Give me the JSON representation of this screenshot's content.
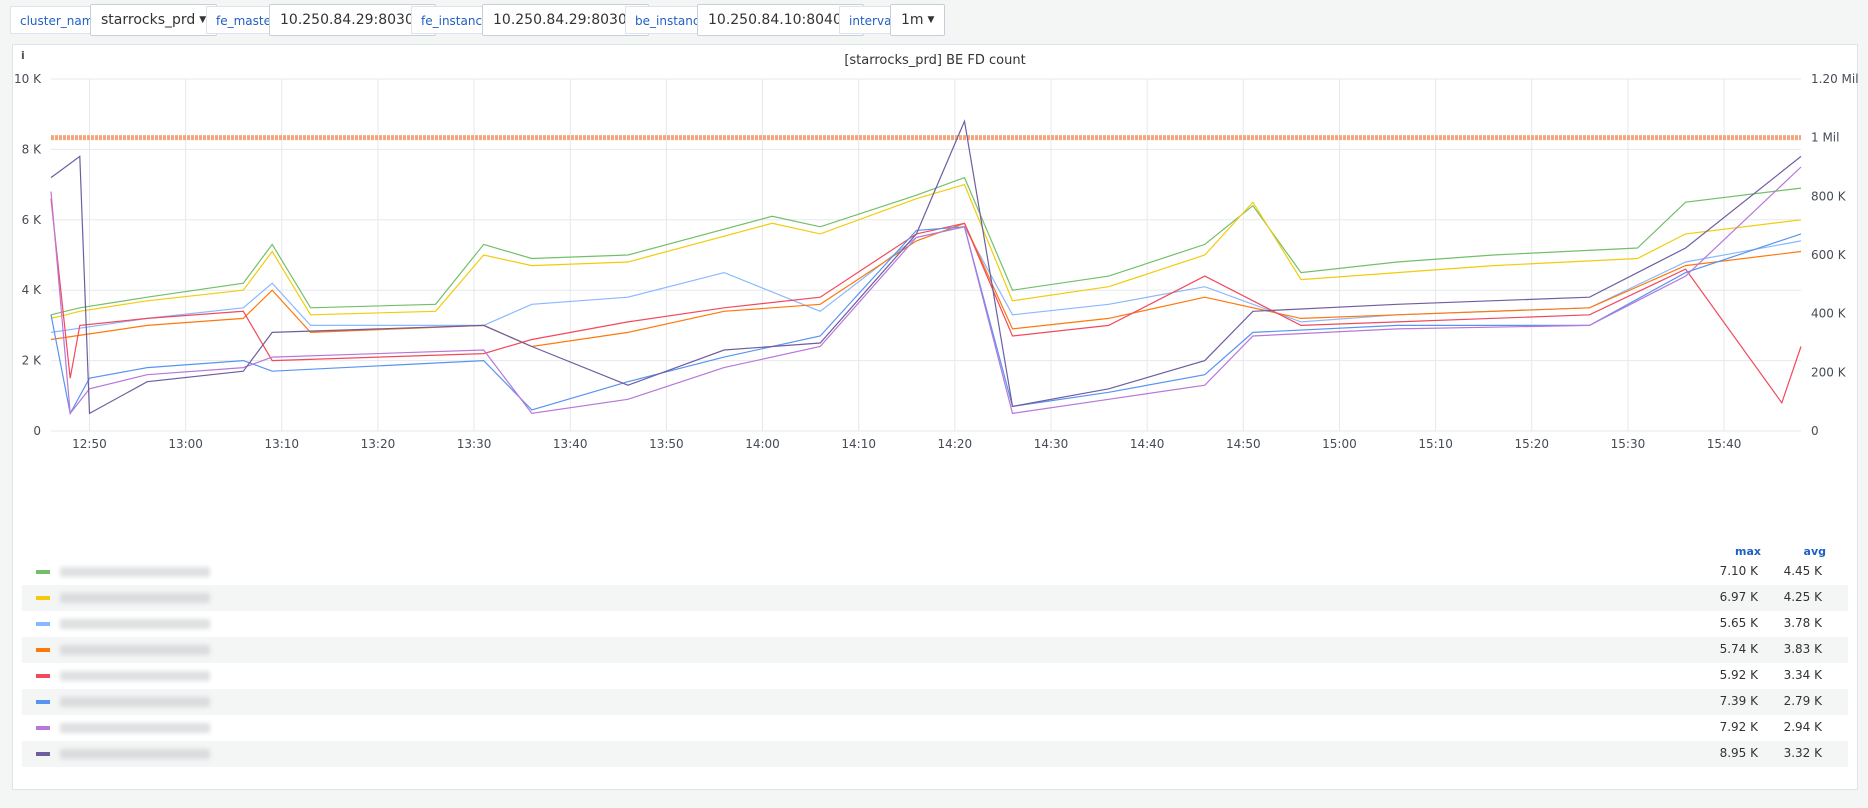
{
  "variables": [
    {
      "label": "cluster_name",
      "value": "starrocks_prd"
    },
    {
      "label": "fe_master",
      "value": "10.250.84.29:8030"
    },
    {
      "label": "fe_instance",
      "value": "10.250.84.29:8030"
    },
    {
      "label": "be_instance",
      "value": "10.250.84.10:8040"
    },
    {
      "label": "interval",
      "value": "1m"
    }
  ],
  "panel": {
    "info_icon": "i",
    "title": "[starrocks_prd] BE FD count"
  },
  "legend": {
    "headers": {
      "max": "max",
      "avg": "avg"
    },
    "rows": [
      {
        "color": "#73bf69",
        "max": "7.10 K",
        "avg": "4.45 K"
      },
      {
        "color": "#f2cc0c",
        "max": "6.97 K",
        "avg": "4.25 K"
      },
      {
        "color": "#8ab8ff",
        "max": "5.65 K",
        "avg": "3.78 K"
      },
      {
        "color": "#ff780a",
        "max": "5.74 K",
        "avg": "3.83 K"
      },
      {
        "color": "#f2495c",
        "max": "5.92 K",
        "avg": "3.34 K"
      },
      {
        "color": "#5794f2",
        "max": "7.39 K",
        "avg": "2.79 K"
      },
      {
        "color": "#b877d9",
        "max": "7.92 K",
        "avg": "2.94 K"
      },
      {
        "color": "#705da0",
        "max": "8.95 K",
        "avg": "3.32 K"
      }
    ]
  },
  "chart_data": {
    "type": "line",
    "title": "[starrocks_prd] BE FD count",
    "xlabel": "",
    "ylabel": "",
    "x_range": [
      "12:46",
      "15:48"
    ],
    "x_ticks": [
      "12:50",
      "13:00",
      "13:10",
      "13:20",
      "13:30",
      "13:40",
      "13:50",
      "14:00",
      "14:10",
      "14:20",
      "14:30",
      "14:40",
      "14:50",
      "15:00",
      "15:10",
      "15:20",
      "15:30",
      "15:40"
    ],
    "y_left": {
      "ticks": [
        "0",
        "2 K",
        "4 K",
        "6 K",
        "8 K",
        "10 K"
      ],
      "range": [
        0,
        10000
      ]
    },
    "y_right": {
      "ticks": [
        "0",
        "200 K",
        "400 K",
        "600 K",
        "800 K",
        "1 Mil",
        "1.20 Mil"
      ],
      "range": [
        0,
        1200000
      ]
    },
    "grid": true,
    "limit_series": {
      "color": "#f4a77c",
      "axis": "right",
      "value": 1000000
    },
    "series": [
      {
        "color": "#73bf69",
        "points": [
          [
            0,
            3300
          ],
          [
            3,
            3500
          ],
          [
            10,
            3800
          ],
          [
            20,
            4200
          ],
          [
            23,
            5300
          ],
          [
            27,
            3500
          ],
          [
            40,
            3600
          ],
          [
            45,
            5300
          ],
          [
            50,
            4900
          ],
          [
            60,
            5000
          ],
          [
            75,
            6100
          ],
          [
            80,
            5800
          ],
          [
            90,
            6700
          ],
          [
            95,
            7200
          ],
          [
            100,
            4000
          ],
          [
            110,
            4400
          ],
          [
            120,
            5300
          ],
          [
            125,
            6400
          ],
          [
            130,
            4500
          ],
          [
            140,
            4800
          ],
          [
            150,
            5000
          ],
          [
            165,
            5200
          ],
          [
            170,
            6500
          ],
          [
            182,
            6900
          ]
        ]
      },
      {
        "color": "#f2cc0c",
        "points": [
          [
            0,
            3200
          ],
          [
            3,
            3400
          ],
          [
            10,
            3700
          ],
          [
            20,
            4000
          ],
          [
            23,
            5100
          ],
          [
            27,
            3300
          ],
          [
            40,
            3400
          ],
          [
            45,
            5000
          ],
          [
            50,
            4700
          ],
          [
            60,
            4800
          ],
          [
            75,
            5900
          ],
          [
            80,
            5600
          ],
          [
            90,
            6600
          ],
          [
            95,
            7000
          ],
          [
            100,
            3700
          ],
          [
            110,
            4100
          ],
          [
            120,
            5000
          ],
          [
            125,
            6500
          ],
          [
            130,
            4300
          ],
          [
            140,
            4500
          ],
          [
            150,
            4700
          ],
          [
            165,
            4900
          ],
          [
            170,
            5600
          ],
          [
            182,
            6000
          ]
        ]
      },
      {
        "color": "#8ab8ff",
        "points": [
          [
            0,
            2800
          ],
          [
            10,
            3200
          ],
          [
            20,
            3500
          ],
          [
            23,
            4200
          ],
          [
            27,
            3000
          ],
          [
            45,
            3000
          ],
          [
            50,
            3600
          ],
          [
            60,
            3800
          ],
          [
            70,
            4500
          ],
          [
            80,
            3400
          ],
          [
            90,
            5500
          ],
          [
            95,
            5800
          ],
          [
            100,
            3300
          ],
          [
            110,
            3600
          ],
          [
            120,
            4100
          ],
          [
            130,
            3100
          ],
          [
            140,
            3300
          ],
          [
            160,
            3500
          ],
          [
            170,
            4800
          ],
          [
            182,
            5400
          ]
        ]
      },
      {
        "color": "#ff780a",
        "points": [
          [
            0,
            2600
          ],
          [
            10,
            3000
          ],
          [
            20,
            3200
          ],
          [
            23,
            4000
          ],
          [
            27,
            2800
          ],
          [
            45,
            3000
          ],
          [
            50,
            2400
          ],
          [
            60,
            2800
          ],
          [
            70,
            3400
          ],
          [
            80,
            3600
          ],
          [
            90,
            5400
          ],
          [
            95,
            5900
          ],
          [
            100,
            2900
          ],
          [
            110,
            3200
          ],
          [
            120,
            3800
          ],
          [
            130,
            3200
          ],
          [
            140,
            3300
          ],
          [
            160,
            3500
          ],
          [
            170,
            4700
          ],
          [
            182,
            5100
          ]
        ]
      },
      {
        "color": "#f2495c",
        "points": [
          [
            0,
            6600
          ],
          [
            2,
            1500
          ],
          [
            3,
            3000
          ],
          [
            10,
            3200
          ],
          [
            20,
            3400
          ],
          [
            23,
            2000
          ],
          [
            45,
            2200
          ],
          [
            50,
            2600
          ],
          [
            60,
            3100
          ],
          [
            70,
            3500
          ],
          [
            80,
            3800
          ],
          [
            90,
            5600
          ],
          [
            95,
            5900
          ],
          [
            100,
            2700
          ],
          [
            110,
            3000
          ],
          [
            120,
            4400
          ],
          [
            130,
            3000
          ],
          [
            140,
            3100
          ],
          [
            160,
            3300
          ],
          [
            170,
            4600
          ],
          [
            180,
            800
          ],
          [
            182,
            2400
          ]
        ]
      },
      {
        "color": "#5794f2",
        "points": [
          [
            0,
            3300
          ],
          [
            2,
            500
          ],
          [
            4,
            1500
          ],
          [
            10,
            1800
          ],
          [
            20,
            2000
          ],
          [
            23,
            1700
          ],
          [
            45,
            2000
          ],
          [
            50,
            600
          ],
          [
            60,
            1400
          ],
          [
            70,
            2100
          ],
          [
            80,
            2700
          ],
          [
            90,
            5700
          ],
          [
            95,
            5800
          ],
          [
            100,
            700
          ],
          [
            110,
            1100
          ],
          [
            120,
            1600
          ],
          [
            125,
            2800
          ],
          [
            140,
            3000
          ],
          [
            160,
            3000
          ],
          [
            170,
            4500
          ],
          [
            182,
            5600
          ]
        ]
      },
      {
        "color": "#b877d9",
        "points": [
          [
            0,
            6800
          ],
          [
            2,
            500
          ],
          [
            4,
            1200
          ],
          [
            10,
            1600
          ],
          [
            20,
            1800
          ],
          [
            23,
            2100
          ],
          [
            45,
            2300
          ],
          [
            50,
            500
          ],
          [
            60,
            900
          ],
          [
            70,
            1800
          ],
          [
            80,
            2400
          ],
          [
            90,
            5500
          ],
          [
            95,
            5800
          ],
          [
            100,
            500
          ],
          [
            110,
            900
          ],
          [
            120,
            1300
          ],
          [
            125,
            2700
          ],
          [
            140,
            2900
          ],
          [
            160,
            3000
          ],
          [
            170,
            4400
          ],
          [
            182,
            7500
          ]
        ]
      },
      {
        "color": "#705da0",
        "points": [
          [
            0,
            7200
          ],
          [
            3,
            7800
          ],
          [
            4,
            500
          ],
          [
            10,
            1400
          ],
          [
            20,
            1700
          ],
          [
            23,
            2800
          ],
          [
            45,
            3000
          ],
          [
            50,
            2400
          ],
          [
            60,
            1300
          ],
          [
            70,
            2300
          ],
          [
            80,
            2500
          ],
          [
            90,
            5600
          ],
          [
            95,
            8800
          ],
          [
            100,
            700
          ],
          [
            110,
            1200
          ],
          [
            120,
            2000
          ],
          [
            125,
            3400
          ],
          [
            140,
            3600
          ],
          [
            160,
            3800
          ],
          [
            170,
            5200
          ],
          [
            182,
            7800
          ]
        ]
      }
    ]
  }
}
